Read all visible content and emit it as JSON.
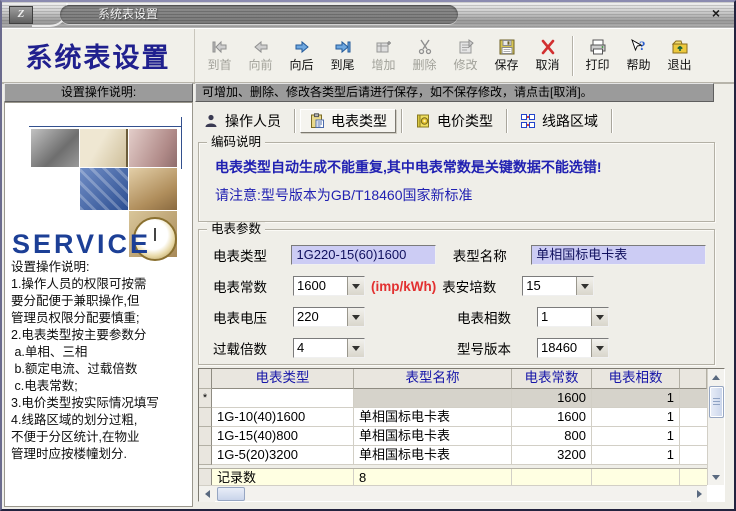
{
  "window": {
    "title": "系统表设置",
    "close_glyph": "×",
    "logo_glyph": "Z"
  },
  "header": {
    "app_title": "系统表设置"
  },
  "toolbar": {
    "buttons": [
      {
        "label": "到首"
      },
      {
        "label": "向前"
      },
      {
        "label": "向后"
      },
      {
        "label": "到尾"
      },
      {
        "label": "增加"
      },
      {
        "label": "删除"
      },
      {
        "label": "修改"
      },
      {
        "label": "保存"
      },
      {
        "label": "取消"
      },
      {
        "label": "打印"
      },
      {
        "label": "帮助"
      },
      {
        "label": "退出"
      }
    ]
  },
  "sidebar": {
    "header": "设置操作说明:",
    "service_text": "SERVICE",
    "instructions": "设置操作说明:\n1.操作人员的权限可按需\n要分配便于兼职操作,但\n管理员权限分配要慎重;\n2.电表类型按主要参数分\n a.单相、三相\n b.额定电流、过载倍数\n c.电表常数;\n3.电价类型按实际情况填写\n4.线路区域的划分过粗,\n不便于分区统计,在物业\n管理时应按楼幢划分."
  },
  "main": {
    "notice": "可增加、删除、修改各类型后请进行保存，如不保存修改，请点击[取消]。",
    "tabs": [
      {
        "label": "操作人员"
      },
      {
        "label": "电表类型"
      },
      {
        "label": "电价类型"
      },
      {
        "label": "线路区域"
      }
    ],
    "coding_box": {
      "legend": "编码说明",
      "line1": "电表类型自动生成不能重复,其中电表常数是关键数据不能选错!",
      "line2": "请注意:型号版本为GB/T18460国家新标准"
    },
    "params_box": {
      "legend": "电表参数",
      "meter_type": {
        "label": "电表类型",
        "value": "1G220-15(60)1600"
      },
      "model_name": {
        "label": "表型名称",
        "value": "单相国标电卡表"
      },
      "meter_constant": {
        "label": "电表常数",
        "value": "1600",
        "unit": "(imp/kWh)"
      },
      "ampere": {
        "label": "表安培数",
        "value": "15"
      },
      "voltage": {
        "label": "电表电压",
        "value": "220"
      },
      "phase": {
        "label": "电表相数",
        "value": "1"
      },
      "overload": {
        "label": "过载倍数",
        "value": "4"
      },
      "version": {
        "label": "型号版本",
        "value": "18460"
      }
    },
    "grid": {
      "columns": [
        "电表类型",
        "表型名称",
        "电表常数",
        "电表相数"
      ],
      "rows": [
        {
          "marker": "*",
          "cells": [
            "",
            "",
            "1600",
            "1"
          ]
        },
        {
          "marker": "",
          "cells": [
            "1G-10(40)1600",
            "单相国标电卡表",
            "1600",
            "1"
          ]
        },
        {
          "marker": "",
          "cells": [
            "1G-15(40)800",
            "单相国标电卡表",
            "800",
            "1"
          ]
        },
        {
          "marker": "",
          "cells": [
            "1G-5(20)3200",
            "单相国标电卡表",
            "3200",
            "1"
          ]
        }
      ],
      "footer": {
        "label": "记录数",
        "value": "8"
      }
    }
  }
}
